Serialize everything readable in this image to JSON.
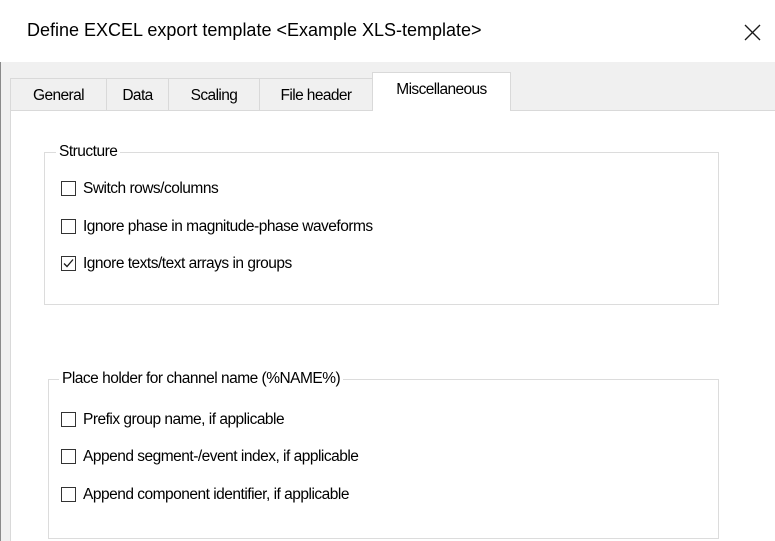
{
  "window": {
    "title": "Define EXCEL export template <Example XLS-template>",
    "close_glyph": "✕"
  },
  "tabs": [
    {
      "label": "General",
      "active": false
    },
    {
      "label": "Data",
      "active": false
    },
    {
      "label": "Scaling",
      "active": false
    },
    {
      "label": "File header",
      "active": false
    },
    {
      "label": "Miscellaneous",
      "active": true
    }
  ],
  "structure_group": {
    "label": "Structure",
    "items": [
      {
        "label": "Switch rows/columns",
        "checked": false
      },
      {
        "label": "Ignore phase in magnitude-phase waveforms",
        "checked": false
      },
      {
        "label": "Ignore texts/text arrays in groups",
        "checked": true
      }
    ]
  },
  "placeholder_group": {
    "label": "Place holder for channel name (%NAME%)",
    "items": [
      {
        "label": "Prefix group name, if applicable",
        "checked": false
      },
      {
        "label": "Append segment-/event index, if applicable",
        "checked": false
      },
      {
        "label": "Append component identifier, if applicable",
        "checked": false
      }
    ]
  },
  "icons": {
    "close": "close-icon",
    "checkmark": "checkmark-icon"
  },
  "colors": {
    "dialog_background": "#f0f0f0",
    "panel_background": "#ffffff",
    "group_border": "#dcdcdc",
    "checkbox_border": "#333333"
  }
}
